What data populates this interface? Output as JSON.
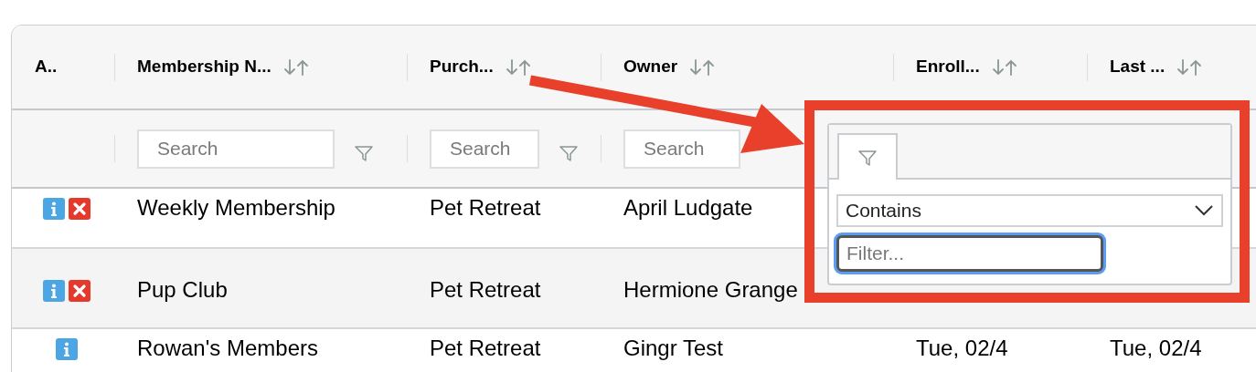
{
  "table": {
    "actions_header": "A..",
    "columns": [
      {
        "label": "Membership N...",
        "sortable": true
      },
      {
        "label": "Purch...",
        "sortable": true
      },
      {
        "label": "Owner",
        "sortable": true
      },
      {
        "label": "Enroll...",
        "sortable": true
      },
      {
        "label": "Last ...",
        "sortable": true
      }
    ],
    "filters": [
      {
        "placeholder": "Search",
        "funnel": true
      },
      {
        "placeholder": "Search",
        "funnel": true
      },
      {
        "placeholder": "Search",
        "funnel": false
      }
    ],
    "rows": [
      {
        "actions": [
          {
            "kind": "info"
          },
          {
            "kind": "delete"
          }
        ],
        "cells": [
          "Weekly Membership",
          "Pet Retreat",
          "April Ludgate"
        ]
      },
      {
        "actions": [
          {
            "kind": "info"
          },
          {
            "kind": "delete"
          }
        ],
        "cells": [
          "Pup Club",
          "Pet Retreat",
          "Hermione Grange"
        ]
      },
      {
        "actions": [
          {
            "kind": "info"
          }
        ],
        "cells": [
          "Rowan's Members",
          "Pet Retreat",
          "Gingr Test",
          "Tue, 02/4",
          "Tue, 02/4"
        ]
      }
    ]
  },
  "filter_popup": {
    "operator": "Contains",
    "placeholder": "Filter...",
    "focused": true
  }
}
